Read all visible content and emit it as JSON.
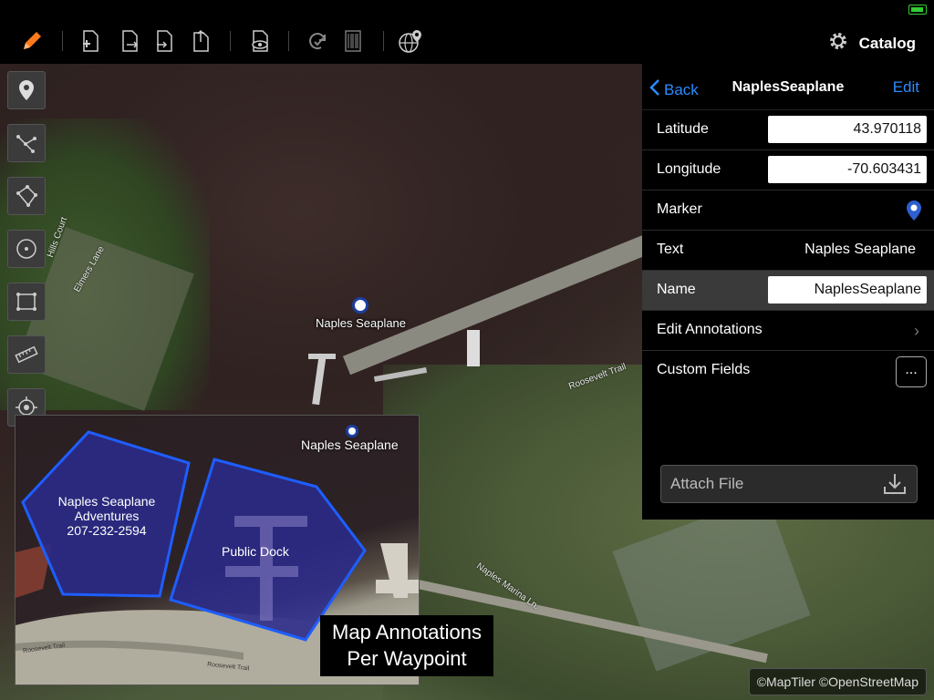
{
  "toolbar": {
    "icons": [
      "pencil-icon",
      "add-waypoint-icon",
      "export-icon",
      "import-icon",
      "share-file-icon",
      "preview-icon",
      "sync-icon",
      "barcode-icon",
      "globe-pin-icon"
    ],
    "catalog_label": "Catalog"
  },
  "map": {
    "waypoint_label": "Naples Seaplane",
    "road_labels": [
      "Roosevelt Trail",
      "Naples Marina Ln.",
      "Elmers Lane",
      "Hills Court"
    ],
    "attribution": "©MapTiler ©OpenStreetMap"
  },
  "tools": [
    "marker-tool-icon",
    "polyline-tool-icon",
    "polygon-tool-icon",
    "circle-tool-icon",
    "rectangle-tool-icon",
    "ruler-tool-icon",
    "locate-tool-icon"
  ],
  "panel": {
    "back_label": "Back",
    "title": "NaplesSeaplane",
    "edit_label": "Edit",
    "rows": {
      "latitude_label": "Latitude",
      "latitude_value": "43.970118",
      "longitude_label": "Longitude",
      "longitude_value": "-70.603431",
      "marker_label": "Marker",
      "text_label": "Text",
      "text_value": "Naples Seaplane",
      "name_label": "Name",
      "name_value": "NaplesSeaplane",
      "edit_annotations_label": "Edit Annotations",
      "custom_fields_label": "Custom Fields",
      "custom_fields_button": "..."
    },
    "attach_label": "Attach File"
  },
  "inset": {
    "waypoint_label": "Naples Seaplane",
    "polygon1_lines": [
      "Naples Seaplane",
      "Adventures",
      "207-232-2594"
    ],
    "polygon2_label": "Public Dock",
    "road_labels": [
      "Roosevelt Trail",
      "Roosevelt Trail"
    ],
    "caption_line1": "Map Annotations",
    "caption_line2": "Per Waypoint"
  },
  "colors": {
    "accent": "#2b8cff",
    "polygon_fill": "#2a2a8a",
    "polygon_stroke": "#1e5eff",
    "pencil": "#ff7a1a"
  }
}
